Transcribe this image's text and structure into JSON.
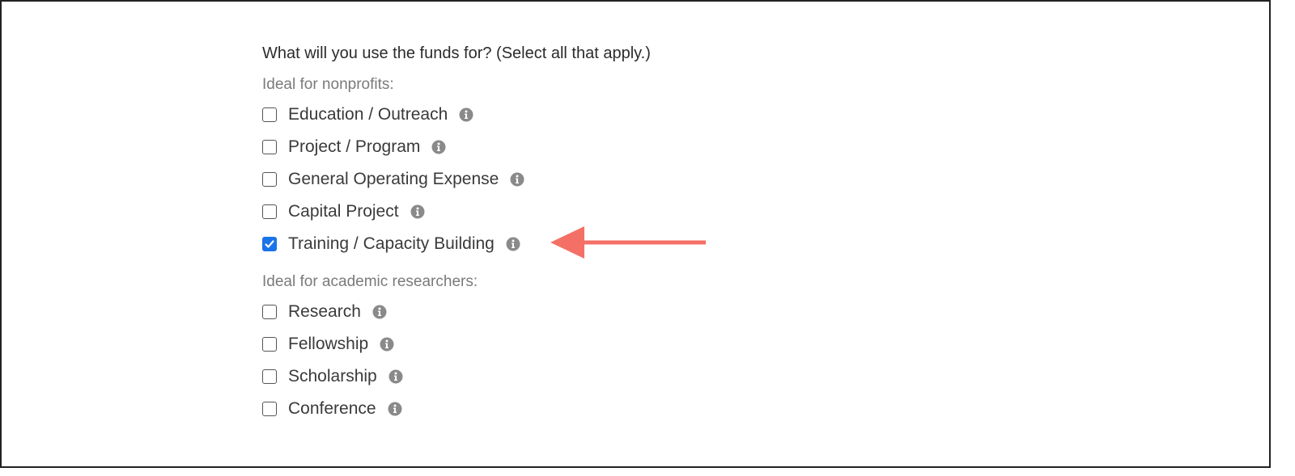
{
  "form": {
    "question": "What will you use the funds for? (Select all that apply.)",
    "groups": [
      {
        "label": "Ideal for nonprofits:",
        "options": [
          {
            "label": "Education / Outreach",
            "checked": false,
            "icon": "info-icon"
          },
          {
            "label": "Project / Program",
            "checked": false,
            "icon": "info-icon"
          },
          {
            "label": "General Operating Expense",
            "checked": false,
            "icon": "info-icon"
          },
          {
            "label": "Capital Project",
            "checked": false,
            "icon": "info-icon"
          },
          {
            "label": "Training / Capacity Building",
            "checked": true,
            "icon": "info-icon"
          }
        ]
      },
      {
        "label": "Ideal for academic researchers:",
        "options": [
          {
            "label": "Research",
            "checked": false,
            "icon": "info-icon"
          },
          {
            "label": "Fellowship",
            "checked": false,
            "icon": "info-icon"
          },
          {
            "label": "Scholarship",
            "checked": false,
            "icon": "info-icon"
          },
          {
            "label": "Conference",
            "checked": false,
            "icon": "info-icon"
          }
        ]
      }
    ]
  },
  "annotation": {
    "arrow_icon": "left-arrow-icon",
    "arrow_color": "#f47066",
    "points_to": "Training / Capacity Building"
  },
  "colors": {
    "checkbox_checked": "#1a73e8",
    "info_icon": "#8a8a8a",
    "group_label": "#7a7a7a",
    "frame_border": "#222222"
  }
}
